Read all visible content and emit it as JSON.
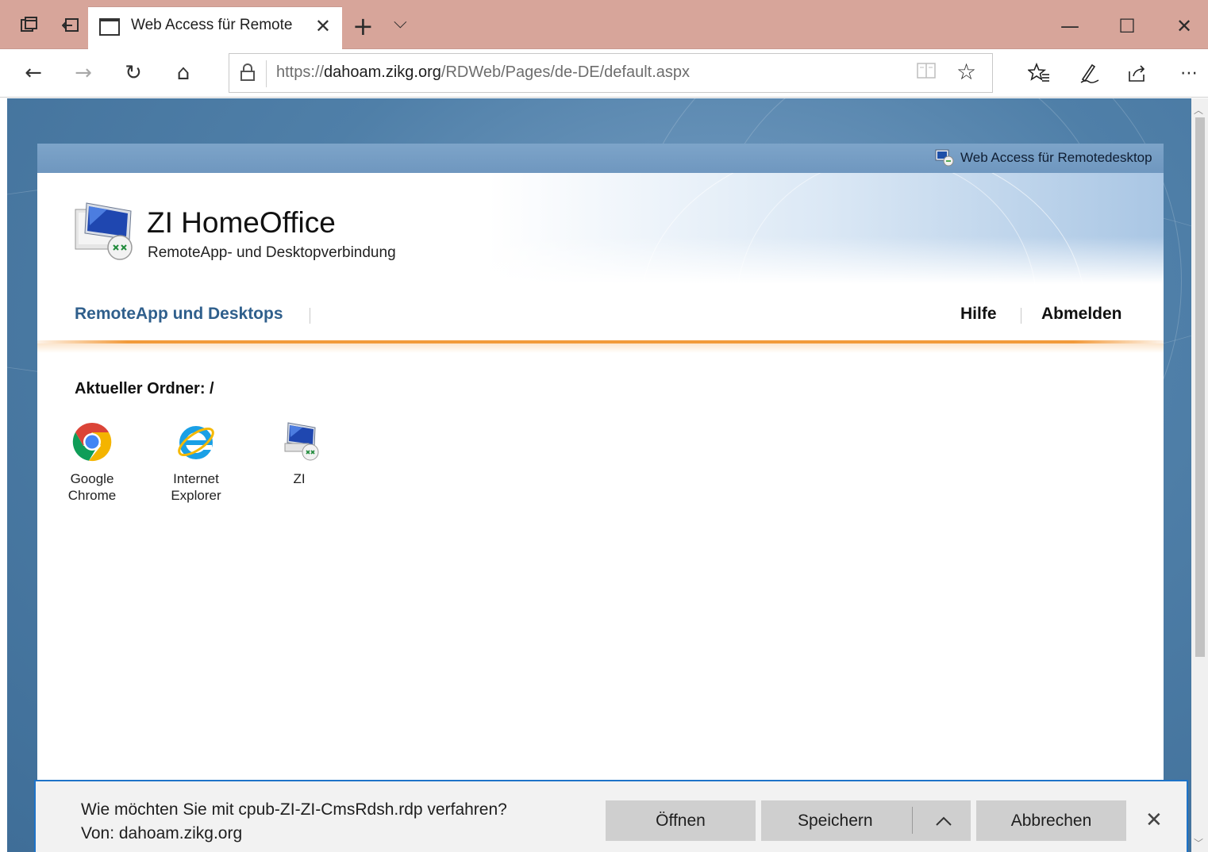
{
  "browser": {
    "tab_title": "Web Access für Remote",
    "tab_close": "✕",
    "new_tab": "+",
    "tab_list": "⌵",
    "window": {
      "minimize": "—",
      "maximize": "☐",
      "close": "✕"
    }
  },
  "navbar": {
    "back": "←",
    "forward": "→",
    "refresh": "↻",
    "home": "⌂",
    "url_scheme": "https://",
    "url_host": "dahoam.zikg.org",
    "url_path": "/RDWeb/Pages/de-DE/default.aspx",
    "reading_view": "📖",
    "favorite": "☆",
    "favorites_hub": "☆≡",
    "notes": "✎",
    "share": "⇪",
    "more": "⋯"
  },
  "rdweb": {
    "topstrip_text": "Web Access für Remotedesktop",
    "title": "ZI HomeOffice",
    "subtitle": "RemoteApp- und Desktopverbindung",
    "nav_active": "RemoteApp und Desktops",
    "nav_help": "Hilfe",
    "nav_logout": "Abmelden",
    "folder_label": "Aktueller Ordner: /",
    "apps": [
      {
        "label_line1": "Google",
        "label_line2": "Chrome",
        "icon": "chrome-icon"
      },
      {
        "label_line1": "Internet",
        "label_line2": "Explorer",
        "icon": "internet-explorer-icon"
      },
      {
        "label_line1": "ZI",
        "label_line2": "",
        "icon": "remote-desktop-icon"
      }
    ]
  },
  "download_bar": {
    "question": "Wie möchten Sie mit cpub-ZI-ZI-CmsRdsh.rdp verfahren?",
    "from": "Von: dahoam.zikg.org",
    "open": "Öffnen",
    "save": "Speichern",
    "save_options": "^",
    "cancel": "Abbrechen",
    "close": "✕"
  },
  "colors": {
    "titlebar": "#d7a59a",
    "nav_active": "#2f5f8c",
    "orange_rule": "#f29a3a",
    "download_border": "#1e73c8"
  }
}
